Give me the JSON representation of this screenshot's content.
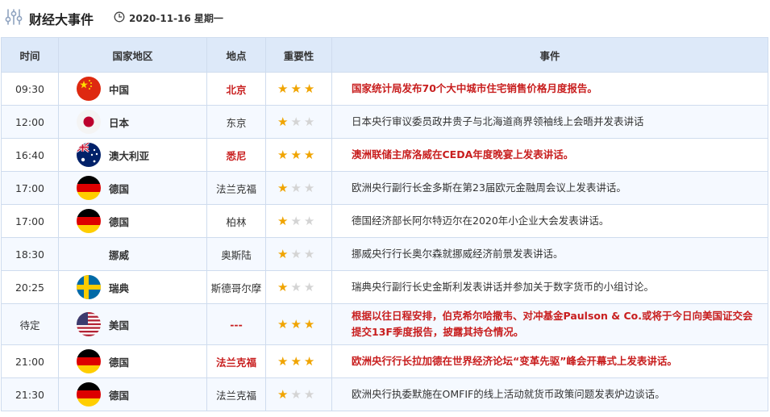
{
  "header": {
    "title": "财经大事件",
    "date": "2020-11-16 星期一"
  },
  "columns": [
    "时间",
    "国家地区",
    "地点",
    "重要性",
    "事件"
  ],
  "rows": [
    {
      "time": "09:30",
      "flag": "china",
      "country": "中国",
      "place": "北京",
      "stars": 3,
      "highlight": true,
      "event": "国家统计局发布70个大中城市住宅销售价格月度报告。"
    },
    {
      "time": "12:00",
      "flag": "japan",
      "country": "日本",
      "place": "东京",
      "stars": 1,
      "highlight": false,
      "event": "日本央行审议委员政井贵子与北海道商界领袖线上会晤并发表讲话"
    },
    {
      "time": "16:40",
      "flag": "australia",
      "country": "澳大利亚",
      "place": "悉尼",
      "stars": 3,
      "highlight": true,
      "event": "澳洲联储主席洛威在CEDA年度晚宴上发表讲话。"
    },
    {
      "time": "17:00",
      "flag": "germany",
      "country": "德国",
      "place": "法兰克福",
      "stars": 1,
      "highlight": false,
      "event": "欧洲央行副行长金多斯在第23届欧元金融周会议上发表讲话。"
    },
    {
      "time": "17:00",
      "flag": "germany",
      "country": "德国",
      "place": "柏林",
      "stars": 1,
      "highlight": false,
      "event": "德国经济部长阿尔特迈尔在2020年小企业大会发表讲话。"
    },
    {
      "time": "18:30",
      "flag": "none",
      "country": "挪威",
      "place": "奥斯陆",
      "stars": 1,
      "highlight": false,
      "event": "挪威央行行长奥尔森就挪威经济前景发表讲话。"
    },
    {
      "time": "20:25",
      "flag": "sweden",
      "country": "瑞典",
      "place": "斯德哥尔摩",
      "stars": 1,
      "highlight": false,
      "event": "瑞典央行副行长史金斯利发表讲话并参加关于数字货币的小组讨论。"
    },
    {
      "time": "待定",
      "flag": "usa",
      "country": "美国",
      "place": "---",
      "stars": 3,
      "highlight": true,
      "event": "根据以往日程安排，伯克希尔哈撒韦、对冲基金Paulson & Co.或将于今日向美国证交会提交13F季度报告，披露其持仓情况。"
    },
    {
      "time": "21:00",
      "flag": "germany",
      "country": "德国",
      "place": "法兰克福",
      "stars": 3,
      "highlight": true,
      "event": "欧洲央行行长拉加德在世界经济论坛“变革先驱”峰会开幕式上发表讲话。"
    },
    {
      "time": "21:30",
      "flag": "germany",
      "country": "德国",
      "place": "法兰克福",
      "stars": 1,
      "highlight": false,
      "event": "欧洲央行执委默施在OMFIF的线上活动就货币政策问题发表炉边谈话。"
    }
  ],
  "colors": {
    "header_bg": "#dde9f9",
    "border": "#cfdcee",
    "highlight_text": "#c81e1e",
    "star_on": "#f0a400",
    "star_off": "#d4d4d4"
  },
  "icons": {
    "logo": "equalizer-sliders-icon",
    "clock": "clock-icon",
    "star": "star-icon"
  }
}
